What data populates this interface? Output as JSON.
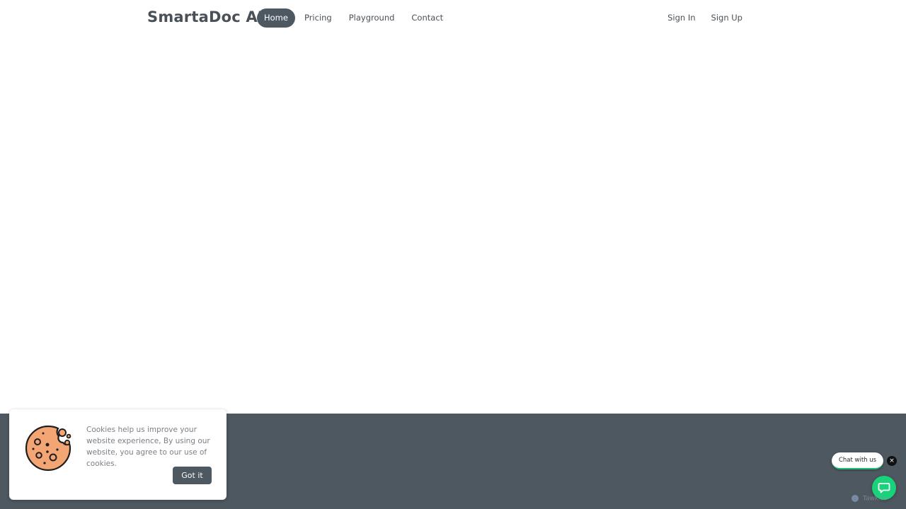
{
  "header": {
    "brand": "SmartaDoc AI",
    "nav": [
      {
        "label": "Home",
        "active": true
      },
      {
        "label": "Pricing",
        "active": false
      },
      {
        "label": "Playground",
        "active": false
      },
      {
        "label": "Contact",
        "active": false
      }
    ],
    "auth": {
      "sign_in": "Sign In",
      "sign_up": "Sign Up"
    }
  },
  "cookie_banner": {
    "icon": "cookie-icon",
    "message": "Cookies help us improve your website experience, By using our website, you agree to our use of cookies.",
    "button_label": "Got it"
  },
  "chat_widget": {
    "pill_label": "Chat with us",
    "close_glyph": "×",
    "launcher_icon": "chat-bubble-icon",
    "branding": "Tawk.to"
  },
  "colors": {
    "primary_dark": "#4e5860",
    "chat_green": "#19d37a",
    "text": "#4a5058"
  }
}
